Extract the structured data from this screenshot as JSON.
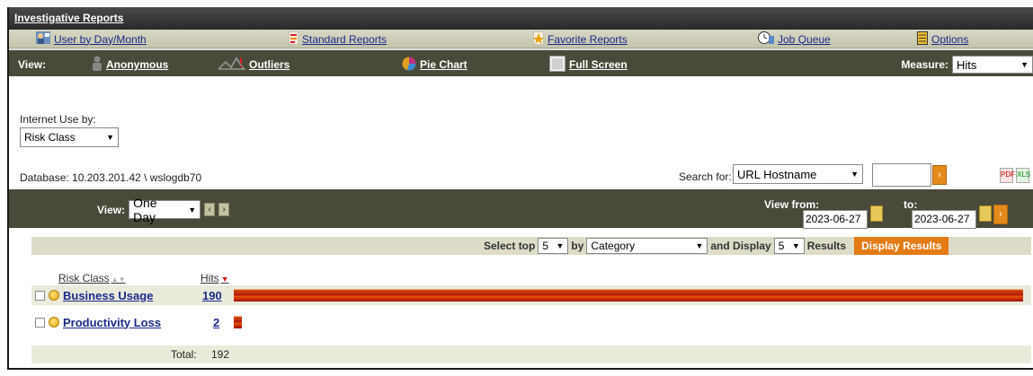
{
  "title": "Investigative Reports",
  "nav": [
    {
      "label": "User by Day/Month",
      "icon": "users-icon"
    },
    {
      "label": "Standard Reports",
      "icon": "report-icon"
    },
    {
      "label": "Favorite Reports",
      "icon": "favorite-icon"
    },
    {
      "label": "Job Queue",
      "icon": "clock-icon"
    },
    {
      "label": "Options",
      "icon": "options-icon"
    }
  ],
  "view": {
    "label": "View:",
    "items": [
      {
        "label": "Anonymous",
        "icon": "anonymous-icon"
      },
      {
        "label": "Outliers",
        "icon": "outliers-icon"
      },
      {
        "label": "Pie Chart",
        "icon": "pie-chart-icon"
      },
      {
        "label": "Full Screen",
        "icon": "full-screen-icon"
      }
    ],
    "measure_label": "Measure:",
    "measure_value": "Hits"
  },
  "internet_use": {
    "label": "Internet Use by:",
    "value": "Risk Class"
  },
  "database": {
    "label": "Database:",
    "value": "10.203.201.42 \\ wslogdb70"
  },
  "search": {
    "label": "Search for:",
    "value": "URL Hostname"
  },
  "date_bar": {
    "view_label": "View:",
    "period": "One Day",
    "from_label": "View from:",
    "from_date": "2023-06-27",
    "to_label": "to:",
    "to_date": "2023-06-27"
  },
  "results_bar": {
    "select_top_label": "Select top",
    "top_value": "5",
    "by_label": "by",
    "by_value": "Category",
    "and_display_label": "and Display",
    "display_value": "5",
    "results_label": "Results",
    "button_label": "Display Results"
  },
  "table": {
    "col_category": "Risk Class",
    "col_hits": "Hits",
    "rows": [
      {
        "name": "Business Usage",
        "hits": "190",
        "fraction": 0.9896
      },
      {
        "name": "Productivity Loss",
        "hits": "2",
        "fraction": 0.0104
      }
    ],
    "total_label": "Total:",
    "total_value": "192"
  },
  "colors": {
    "accent": "#e47a14",
    "dark_bar": "#4a4a3a",
    "link": "#1a2a8a"
  }
}
